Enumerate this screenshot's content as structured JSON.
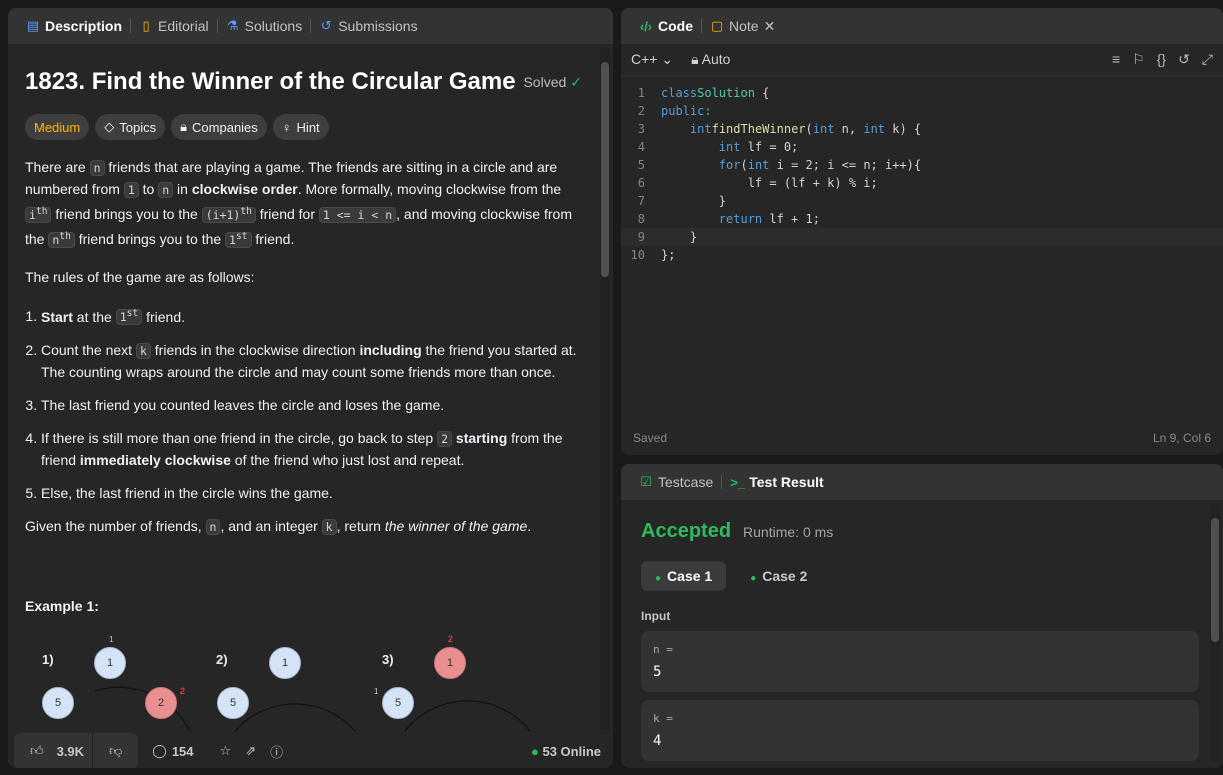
{
  "left_tabs": [
    {
      "label": "Description",
      "icon": "description-icon"
    },
    {
      "label": "Editorial",
      "icon": "book-icon"
    },
    {
      "label": "Solutions",
      "icon": "flask-icon"
    },
    {
      "label": "Submissions",
      "icon": "history-icon"
    }
  ],
  "problem": {
    "title": "1823. Find the Winner of the Circular Game",
    "status": "Solved",
    "difficulty": "Medium",
    "chips": [
      "Topics",
      "Companies",
      "Hint"
    ],
    "para1": {
      "t1": "There are ",
      "c1": "n",
      "t2": " friends that are playing a game. The friends are sitting in a circle and are numbered from ",
      "c2": "1",
      "t3": " to ",
      "c3": "n",
      "t4": " in ",
      "b1": "clockwise order",
      "t5": ". More formally, moving clockwise from the ",
      "c4": "i",
      "s4": "th",
      "t6": " friend brings you to the ",
      "c5": "(i+1)",
      "s5": "th",
      "t7": " friend for ",
      "c6": "1 <= i < n",
      "t8": ", and moving clockwise from the ",
      "c7": "n",
      "s7": "th",
      "t9": " friend brings you to the ",
      "c8": "1",
      "s8": "st",
      "t10": " friend."
    },
    "rules_intro": "The rules of the game are as follows:",
    "rule1": {
      "b": "Start",
      "t1": " at the ",
      "c": "1",
      "s": "st",
      "t2": " friend."
    },
    "rule2": {
      "t1": "Count the next ",
      "c": "k",
      "t2": " friends in the clockwise direction ",
      "b": "including",
      "t3": " the friend you started at. The counting wraps around the circle and may count some friends more than once."
    },
    "rule3": "The last friend you counted leaves the circle and loses the game.",
    "rule4": {
      "t1": "If there is still more than one friend in the circle, go back to step ",
      "c": "2",
      "b1": "starting",
      "t2": " from the friend ",
      "b2": "immediately clockwise",
      "t3": " of the friend who just lost and repeat."
    },
    "rule5": "Else, the last friend in the circle wins the game.",
    "given": {
      "t1": "Given the number of friends, ",
      "c1": "n",
      "t2": ", and an integer ",
      "c2": "k",
      "t3": ", return ",
      "i": "the winner of the game",
      "t4": "."
    },
    "example_title": "Example 1:",
    "diagram": {
      "steps": [
        "1)",
        "2)",
        "3)"
      ],
      "step1": {
        "top": "1",
        "left": "5",
        "right": "2",
        "top_mark": "1",
        "right_mark": "2"
      },
      "step2": {
        "top": "1",
        "left": "5"
      },
      "step3": {
        "top": "1",
        "left": "5",
        "top_mark": "2",
        "left_mark": "1"
      }
    }
  },
  "footer": {
    "likes": "3.9K",
    "comments": "154",
    "online": "53 Online"
  },
  "code_tabs": [
    {
      "label": "Code",
      "icon": "code-icon"
    },
    {
      "label": "Note",
      "icon": "note-icon"
    }
  ],
  "code_toolbar": {
    "language": "C++",
    "mode": "Auto"
  },
  "code_status": {
    "left": "Saved",
    "right": "Ln 9, Col 6"
  },
  "code_line_numbers": [
    "1",
    "2",
    "3",
    "4",
    "5",
    "6",
    "7",
    "8",
    "9",
    "10"
  ],
  "code_lines": {
    "l1a": "class",
    "l1b": "Solution",
    "l1c": " {",
    "l2": "public:",
    "l3a": "int",
    "l3b": "findTheWinner",
    "l3c": "(",
    "l3d": "int",
    "l3e": " n, ",
    "l3f": "int",
    "l3g": " k) {",
    "l4a": "int",
    "l4b": " lf = 0;",
    "l5a": "for",
    "l5b": "(",
    "l5c": "int",
    "l5d": " i = 2; i <= n; i++){",
    "l6": "lf = (lf + k) % i;",
    "l7": "}",
    "l8a": "return",
    "l8b": " lf + 1;",
    "l9": "}",
    "l10": "};"
  },
  "test_tabs": [
    {
      "label": "Testcase",
      "icon": "check-box-icon"
    },
    {
      "label": "Test Result",
      "icon": "terminal-icon"
    }
  ],
  "result": {
    "status": "Accepted",
    "runtime": "Runtime: 0 ms",
    "cases": [
      "Case 1",
      "Case 2"
    ],
    "input_label": "Input",
    "inputs": [
      {
        "name": "n =",
        "value": "5"
      },
      {
        "name": "k =",
        "value": "4"
      }
    ]
  }
}
